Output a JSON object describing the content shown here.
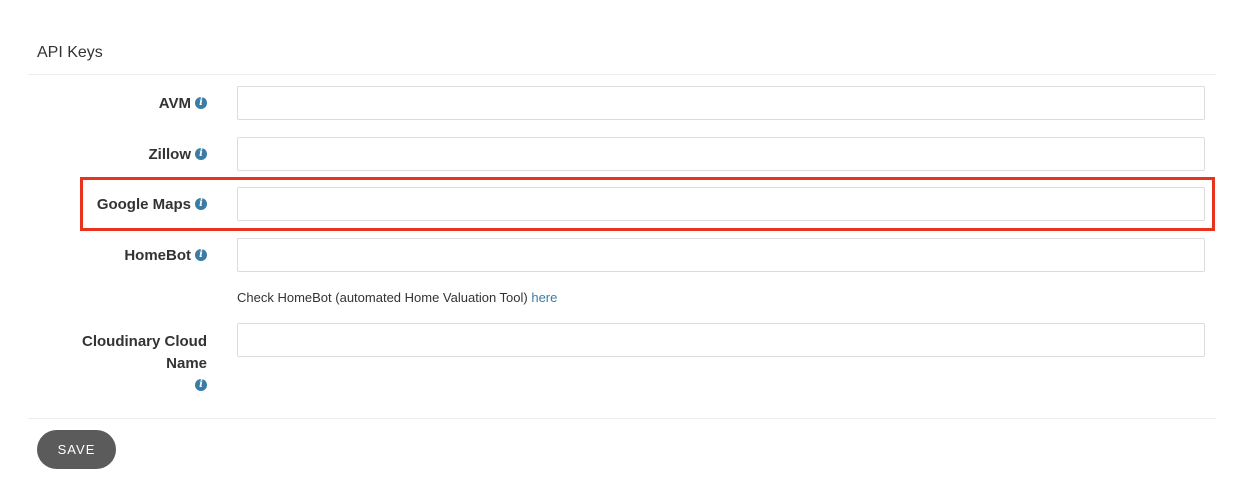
{
  "section": {
    "title": "API Keys"
  },
  "fields": {
    "avm": {
      "label": "AVM",
      "value": "",
      "icon": "info-icon"
    },
    "zillow": {
      "label": "Zillow",
      "value": "",
      "icon": "info-icon"
    },
    "google_maps": {
      "label": "Google Maps",
      "value": "",
      "icon": "info-icon"
    },
    "homebot": {
      "label": "HomeBot",
      "value": "",
      "icon": "info-icon"
    },
    "cloudinary": {
      "label_line1": "Cloudinary Cloud",
      "label_line2": "Name",
      "value": "",
      "icon": "info-icon"
    }
  },
  "homebot_help": {
    "text": "Check HomeBot (automated Home Valuation Tool) ",
    "link": "here"
  },
  "actions": {
    "save_label": "SAVE"
  },
  "colors": {
    "highlight": "#e8321e",
    "info_icon": "#3a7ca5",
    "save_button": "#5b5b5b",
    "link": "#3a7ca5"
  }
}
